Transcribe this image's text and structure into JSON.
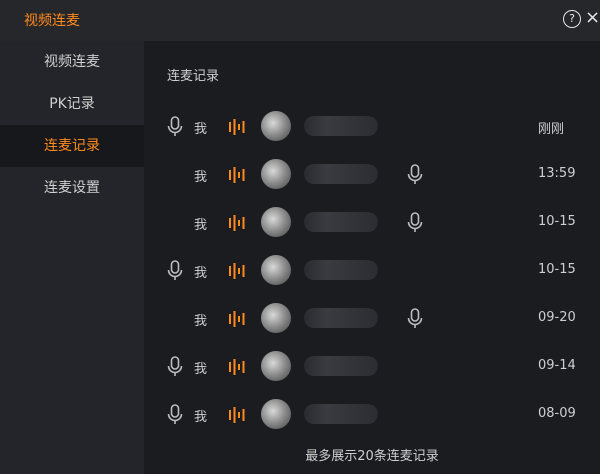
{
  "window": {
    "title": "视频连麦",
    "help_label": "?",
    "close_label": "×"
  },
  "sidebar": {
    "items": [
      {
        "label": "视频连麦",
        "active": false
      },
      {
        "label": "PK记录",
        "active": false
      },
      {
        "label": "连麦记录",
        "active": true
      },
      {
        "label": "连麦设置",
        "active": false
      }
    ]
  },
  "main": {
    "section_title": "连麦记录",
    "me_label": "我",
    "records": [
      {
        "time": "刚刚",
        "left_mic": true,
        "right_mic": false
      },
      {
        "time": "13:59",
        "left_mic": false,
        "right_mic": true
      },
      {
        "time": "10-15",
        "left_mic": false,
        "right_mic": true
      },
      {
        "time": "10-15",
        "left_mic": true,
        "right_mic": false
      },
      {
        "time": "09-20",
        "left_mic": false,
        "right_mic": true
      },
      {
        "time": "09-14",
        "left_mic": true,
        "right_mic": false
      },
      {
        "time": "08-09",
        "left_mic": true,
        "right_mic": false
      }
    ],
    "footer_note": "最多展示20条连麦记录"
  },
  "colors": {
    "accent": "#ff8a1c",
    "background": "#1b1c20",
    "sidebar": "#24252a",
    "text": "#cfcfcf"
  }
}
